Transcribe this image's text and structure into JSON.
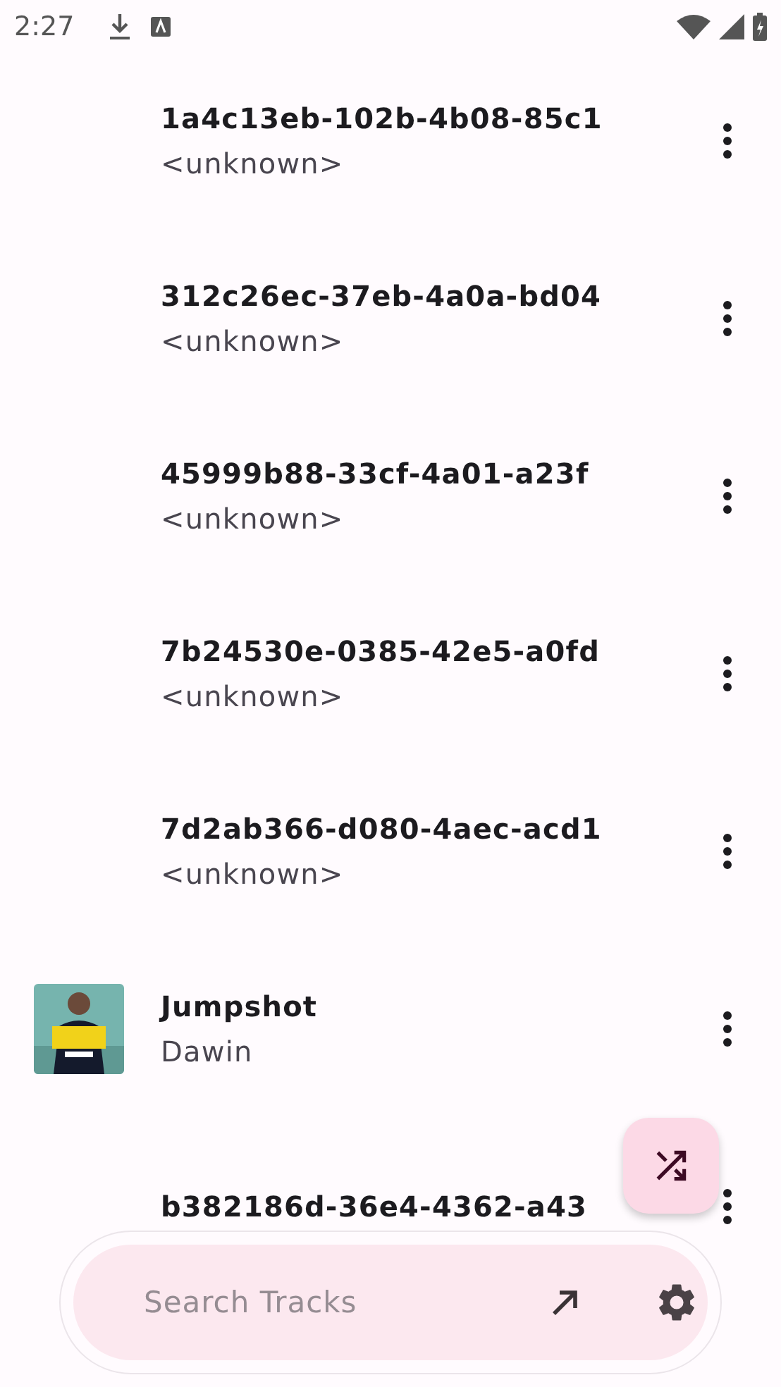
{
  "status_bar": {
    "time": "2:27"
  },
  "tracks": [
    {
      "title": "1a4c13eb-102b-4b08-85c1",
      "artist": "<unknown>"
    },
    {
      "title": "312c26ec-37eb-4a0a-bd04",
      "artist": "<unknown>"
    },
    {
      "title": "45999b88-33cf-4a01-a23f",
      "artist": "<unknown>"
    },
    {
      "title": "7b24530e-0385-42e5-a0fd",
      "artist": "<unknown>"
    },
    {
      "title": "7d2ab366-d080-4aec-acd1",
      "artist": "<unknown>"
    },
    {
      "title": "Jumpshot",
      "artist": "Dawin"
    },
    {
      "title": "b382186d-36e4-4362-a43"
    }
  ],
  "search": {
    "placeholder": "Search Tracks"
  }
}
